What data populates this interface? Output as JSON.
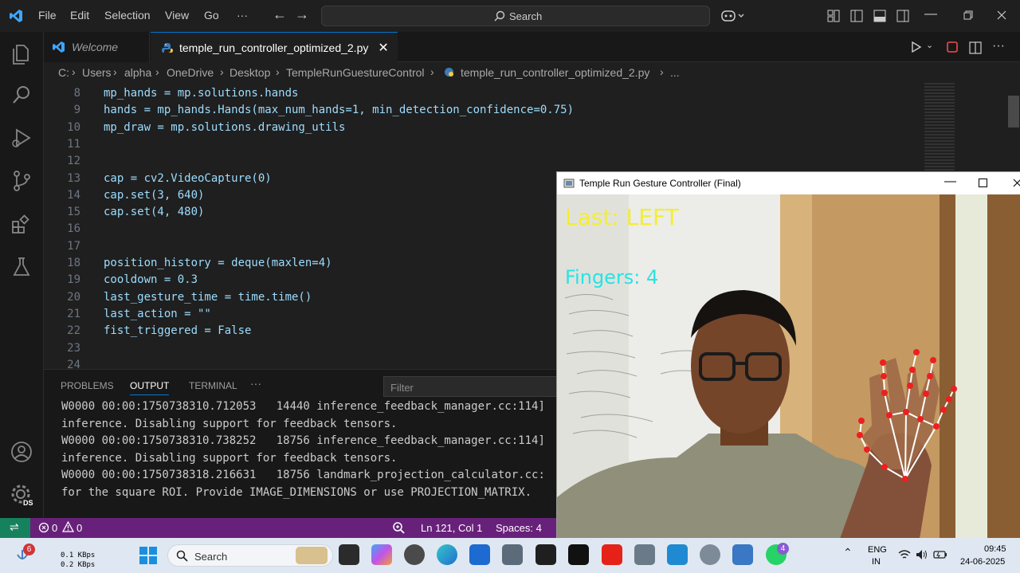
{
  "titlebar": {
    "menu": [
      "File",
      "Edit",
      "Selection",
      "View",
      "Go",
      "···"
    ],
    "search_placeholder": "Search"
  },
  "tabs": [
    {
      "label": "Welcome",
      "active": false
    },
    {
      "label": "temple_run_controller_optimized_2.py",
      "active": true
    }
  ],
  "breadcrumb": [
    "C:",
    "Users",
    "alpha",
    "OneDrive",
    "Desktop",
    "TempleRunGuestureControl",
    "temple_run_controller_optimized_2.py",
    "..."
  ],
  "editor": {
    "lines": [
      {
        "n": "8",
        "code": "mp_hands = mp.solutions.hands"
      },
      {
        "n": "9",
        "code": "hands = mp_hands.Hands(max_num_hands=1, min_detection_confidence=0.75)"
      },
      {
        "n": "10",
        "code": "mp_draw = mp.solutions.drawing_utils"
      },
      {
        "n": "11",
        "code": ""
      },
      {
        "n": "12",
        "code": ""
      },
      {
        "n": "13",
        "code": "cap = cv2.VideoCapture(0)"
      },
      {
        "n": "14",
        "code": "cap.set(3, 640)"
      },
      {
        "n": "15",
        "code": "cap.set(4, 480)"
      },
      {
        "n": "16",
        "code": ""
      },
      {
        "n": "17",
        "code": ""
      },
      {
        "n": "18",
        "code": "position_history = deque(maxlen=4)"
      },
      {
        "n": "19",
        "code": "cooldown = 0.3"
      },
      {
        "n": "20",
        "code": "last_gesture_time = time.time()"
      },
      {
        "n": "21",
        "code": "last_action = \"\""
      },
      {
        "n": "22",
        "code": "fist_triggered = False"
      },
      {
        "n": "23",
        "code": ""
      },
      {
        "n": "24",
        "code": ""
      }
    ]
  },
  "panel": {
    "tabs": [
      "PROBLEMS",
      "OUTPUT",
      "TERMINAL",
      "···"
    ],
    "active_tab": "OUTPUT",
    "filter_placeholder": "Filter",
    "output": [
      "W0000 00:00:1750738310.712053   14440 inference_feedback_manager.cc:114]",
      "inference. Disabling support for feedback tensors.",
      "W0000 00:00:1750738310.738252   18756 inference_feedback_manager.cc:114]",
      "inference. Disabling support for feedback tensors.",
      "W0000 00:00:1750738318.216631   18756 landmark_projection_calculator.cc:",
      "for the square ROI. Provide IMAGE_DIMENSIONS or use PROJECTION_MATRIX."
    ]
  },
  "statusbar": {
    "errors": "0",
    "warnings": "0",
    "position": "Ln 121, Col 1",
    "spaces": "Spaces: 4",
    "accent": "#68217a"
  },
  "camera_window": {
    "title": "Temple Run Gesture Controller (Final)",
    "last_label": "Last:  LEFT",
    "fingers_label": "Fingers: 4"
  },
  "taskbar": {
    "weather_badge": "6",
    "net_up": "0.1 KBps",
    "net_down": "0.2 KBps",
    "search": "Search",
    "whatsapp_badge": "4",
    "lang_top": "ENG",
    "lang_bottom": "IN",
    "time": "09:45",
    "date": "24-06-2025"
  },
  "activity": {
    "account_badge": "DS"
  }
}
